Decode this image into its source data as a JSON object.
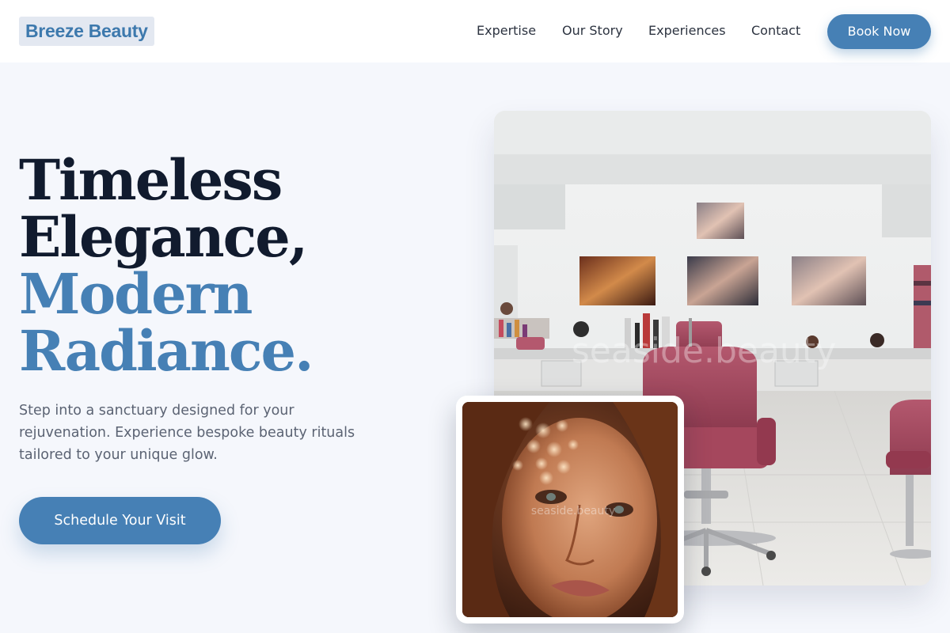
{
  "brand": {
    "name": "Breeze Beauty"
  },
  "nav": {
    "links": [
      "Expertise",
      "Our Story",
      "Experiences",
      "Contact"
    ],
    "cta": "Book Now"
  },
  "hero": {
    "title_dark": [
      "Timeless",
      "Elegance,"
    ],
    "title_accent": [
      "Modern",
      "Radiance."
    ],
    "subtitle": "Step into a sanctuary designed for your rejuvenation. Experience bespoke beauty rituals tailored to your unique glow.",
    "cta": "Schedule Your Visit"
  },
  "images": {
    "salon_watermark": "seaside.beauty",
    "portrait_watermark": "seaside.beauty"
  },
  "colors": {
    "accent": "#4680b5",
    "heading_dark": "#111b2e",
    "page_bg": "#f5f7fc",
    "logo_bg": "#e3e8f1"
  }
}
